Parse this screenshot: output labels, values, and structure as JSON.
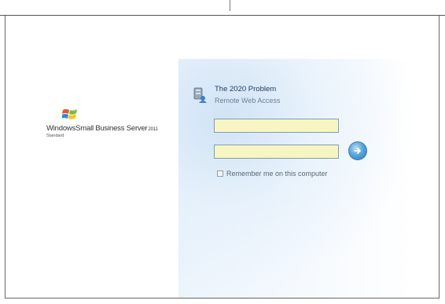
{
  "logo": {
    "brand": "Windows",
    "product": "Small Business Server",
    "year": "2011",
    "edition": "Standard"
  },
  "login": {
    "title": "The 2020 Problem",
    "subtitle": "Remote Web Access",
    "username": {
      "value": "",
      "placeholder": ""
    },
    "password": {
      "value": "",
      "placeholder": ""
    },
    "remember_label": "Remember me on this computer",
    "remember_checked": false
  },
  "colors": {
    "input_bg": "#f7f5c2",
    "accent": "#2a7bbd",
    "title_text": "#1d3a5c"
  },
  "icons": {
    "flag": "windows-flag-icon",
    "server": "server-users-icon",
    "go": "arrow-right-icon"
  }
}
